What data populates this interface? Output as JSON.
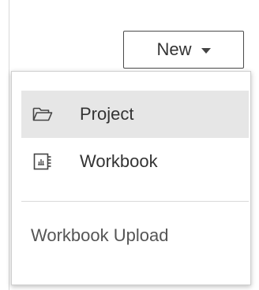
{
  "toolbar": {
    "new_button_label": "New"
  },
  "menu": {
    "items": [
      {
        "label": "Project",
        "icon": "folder-icon"
      },
      {
        "label": "Workbook",
        "icon": "workbook-icon"
      }
    ],
    "upload_label": "Workbook Upload"
  },
  "colors": {
    "highlight": "#e6e6e6",
    "text": "#333333",
    "border": "#4a4a4a"
  }
}
